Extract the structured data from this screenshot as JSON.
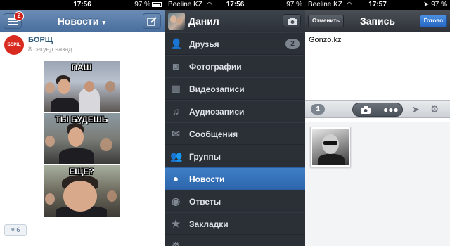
{
  "status_bars": [
    {
      "carrier": "",
      "time": "17:56",
      "battery": "97 %"
    },
    {
      "carrier": "Beeline KZ",
      "time": "17:56",
      "battery": "97 %"
    },
    {
      "carrier": "Beeline KZ",
      "time": "17:57",
      "battery": "97 %"
    }
  ],
  "feed": {
    "title": "Новости",
    "menu_badge": "2",
    "post": {
      "author": "БОРЩ",
      "avatar_text": "БОРЩ",
      "time": "8 секунд назад",
      "meme_captions": [
        "ПАШ",
        "ТЫ БУДЕШЬ",
        "ЕЩЕ?"
      ],
      "likes": "6"
    }
  },
  "menu": {
    "user_name": "Данил",
    "items": [
      {
        "label": "Друзья",
        "icon": "friends-icon",
        "count": "2"
      },
      {
        "label": "Фотографии",
        "icon": "camera-icon"
      },
      {
        "label": "Видеозаписи",
        "icon": "film-icon"
      },
      {
        "label": "Аудиозаписи",
        "icon": "music-icon"
      },
      {
        "label": "Сообщения",
        "icon": "envelope-icon"
      },
      {
        "label": "Группы",
        "icon": "groups-icon"
      },
      {
        "label": "Новости",
        "icon": "speech-bubble-icon",
        "active": true
      },
      {
        "label": "Ответы",
        "icon": "replies-icon"
      },
      {
        "label": "Закладки",
        "icon": "star-icon"
      }
    ]
  },
  "compose": {
    "title": "Запись",
    "cancel_label": "Отменить",
    "done_label": "Готово",
    "text": "Gonzo.kz",
    "attachment_count": "1"
  },
  "colors": {
    "vk_blue": "#4a6f9e",
    "menu_active": "#3f7ec5",
    "menu_bg": "#2b2f36",
    "badge_red": "#d0221b",
    "done_blue": "#2766c2"
  }
}
